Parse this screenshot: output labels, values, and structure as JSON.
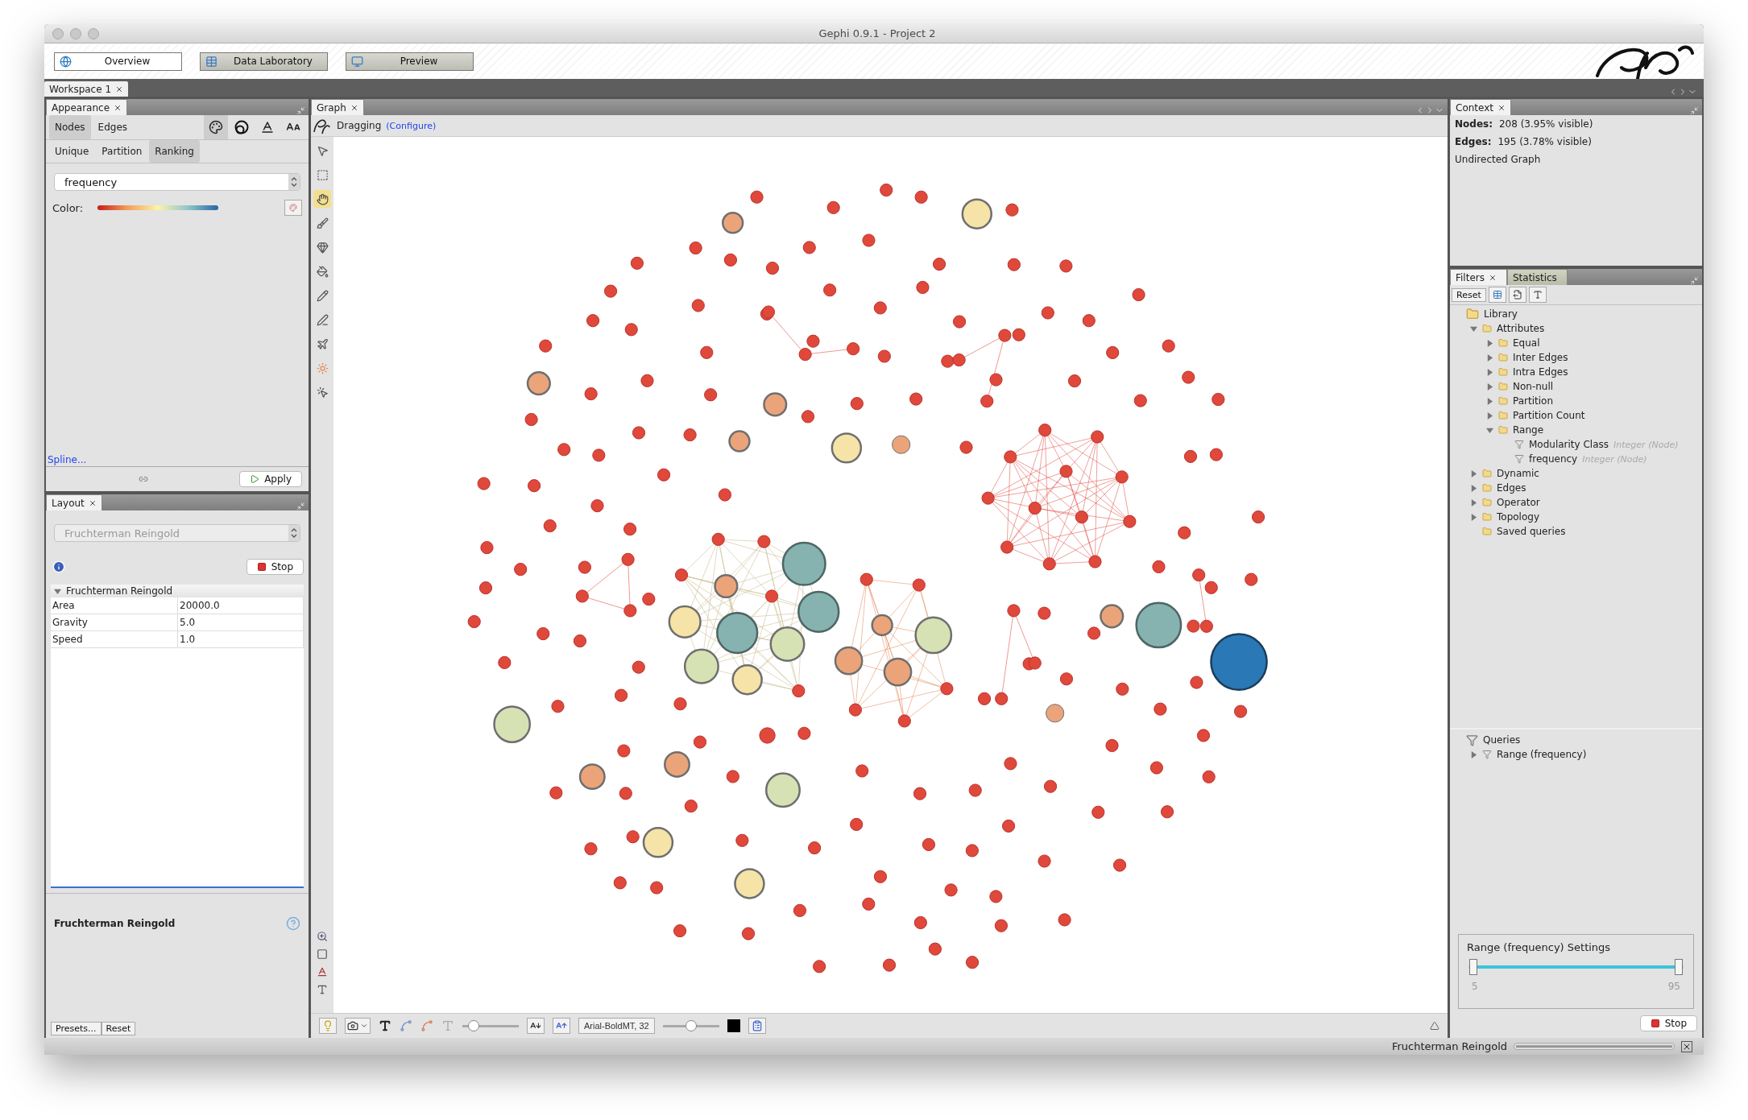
{
  "window": {
    "title": "Gephi 0.9.1 - Project 2"
  },
  "main_toolbar": {
    "buttons": [
      {
        "label": "Overview",
        "kind": "globe",
        "selected": true
      },
      {
        "label": "Data Laboratory",
        "kind": "table",
        "selected": false
      },
      {
        "label": "Preview",
        "kind": "monitor",
        "selected": false
      }
    ]
  },
  "workspace_tabs": [
    {
      "label": "Workspace 1",
      "selected": true
    }
  ],
  "appearance": {
    "title": "Appearance",
    "element_tabs": [
      {
        "label": "Nodes",
        "selected": true
      },
      {
        "label": "Edges",
        "selected": false
      }
    ],
    "properties": [
      {
        "kind": "color",
        "selected": true
      },
      {
        "kind": "size",
        "selected": false
      },
      {
        "kind": "label-color",
        "selected": false
      },
      {
        "kind": "label-size",
        "selected": false
      }
    ],
    "modes": [
      {
        "label": "Unique",
        "selected": false
      },
      {
        "label": "Partition",
        "selected": false
      },
      {
        "label": "Ranking",
        "selected": true
      }
    ],
    "attribute": "frequency",
    "color_label": "Color:",
    "spline_link": "Spline...",
    "apply_button": "Apply"
  },
  "layout": {
    "title": "Layout",
    "algorithm": "Fruchterman Reingold",
    "stop_button": "Stop",
    "section": {
      "label": "Fruchterman Reingold",
      "expanded": true
    },
    "properties": [
      {
        "name": "Area",
        "value": "20000.0"
      },
      {
        "name": "Gravity",
        "value": "5.0"
      },
      {
        "name": "Speed",
        "value": "1.0"
      }
    ],
    "description_title": "Fruchterman Reingold",
    "presets_button": "Presets...",
    "reset_button": "Reset"
  },
  "graph": {
    "title": "Graph",
    "tool_label": "Dragging",
    "configure_link": "(Configure)",
    "tools": [
      {
        "kind": "pointer",
        "selected": false
      },
      {
        "kind": "rect-select",
        "selected": false
      },
      {
        "kind": "drag",
        "selected": true
      },
      {
        "kind": "brush",
        "selected": false
      },
      {
        "kind": "gem",
        "selected": false
      },
      {
        "kind": "bucket",
        "selected": false
      },
      {
        "kind": "pencil",
        "selected": false
      },
      {
        "kind": "pen",
        "selected": false
      },
      {
        "kind": "plane",
        "selected": false
      },
      {
        "kind": "sun",
        "selected": false
      },
      {
        "kind": "click",
        "selected": false
      }
    ],
    "bottom_sliders": [
      {
        "level": 0.2
      },
      {
        "level": 0.5
      }
    ],
    "font_button": "Arial-BoldMT, 32"
  },
  "context": {
    "title": "Context",
    "stats": [
      {
        "label": "Nodes:",
        "value": "208 (3.95% visible)"
      },
      {
        "label": "Edges:",
        "value": "195 (3.78% visible)"
      }
    ],
    "graph_type": "Undirected Graph"
  },
  "filters": {
    "tabs": [
      {
        "label": "Filters",
        "selected": true
      },
      {
        "label": "Statistics",
        "selected": false
      }
    ],
    "reset_button": "Reset",
    "library": {
      "label": "Library",
      "kind": "library",
      "children": [
        {
          "label": "Attributes",
          "kind": "folder",
          "expanded": true,
          "children": [
            {
              "label": "Equal",
              "kind": "folder",
              "expanded": false
            },
            {
              "label": "Inter Edges",
              "kind": "folder",
              "expanded": false
            },
            {
              "label": "Intra Edges",
              "kind": "folder",
              "expanded": false
            },
            {
              "label": "Non-null",
              "kind": "folder",
              "expanded": false
            },
            {
              "label": "Partition",
              "kind": "folder",
              "expanded": false
            },
            {
              "label": "Partition Count",
              "kind": "folder",
              "expanded": false
            },
            {
              "label": "Range",
              "kind": "folder",
              "expanded": true,
              "children": [
                {
                  "label": "Modularity Class",
                  "kind": "filter",
                  "type": "Integer (Node)"
                },
                {
                  "label": "frequency",
                  "kind": "filter",
                  "type": "Integer (Node)"
                }
              ]
            }
          ]
        },
        {
          "label": "Dynamic",
          "kind": "folder",
          "expanded": false
        },
        {
          "label": "Edges",
          "kind": "folder",
          "expanded": false
        },
        {
          "label": "Operator",
          "kind": "folder",
          "expanded": false
        },
        {
          "label": "Topology",
          "kind": "folder",
          "expanded": false
        },
        {
          "label": "Saved queries",
          "kind": "folder"
        }
      ]
    },
    "queries": {
      "label": "Queries",
      "kind": "queries",
      "children": [
        {
          "label": "Range (frequency)",
          "kind": "filter",
          "expanded": false
        }
      ]
    },
    "settings": {
      "title": "Range (frequency) Settings",
      "thumbs": [
        {
          "level": 0
        },
        {
          "level": 1
        }
      ],
      "min_label": "5",
      "max_label": "95"
    },
    "stop_button": "Stop"
  },
  "status_bar": {
    "task": "Fruchterman Reingold",
    "progress": {
      "level": 1
    }
  }
}
